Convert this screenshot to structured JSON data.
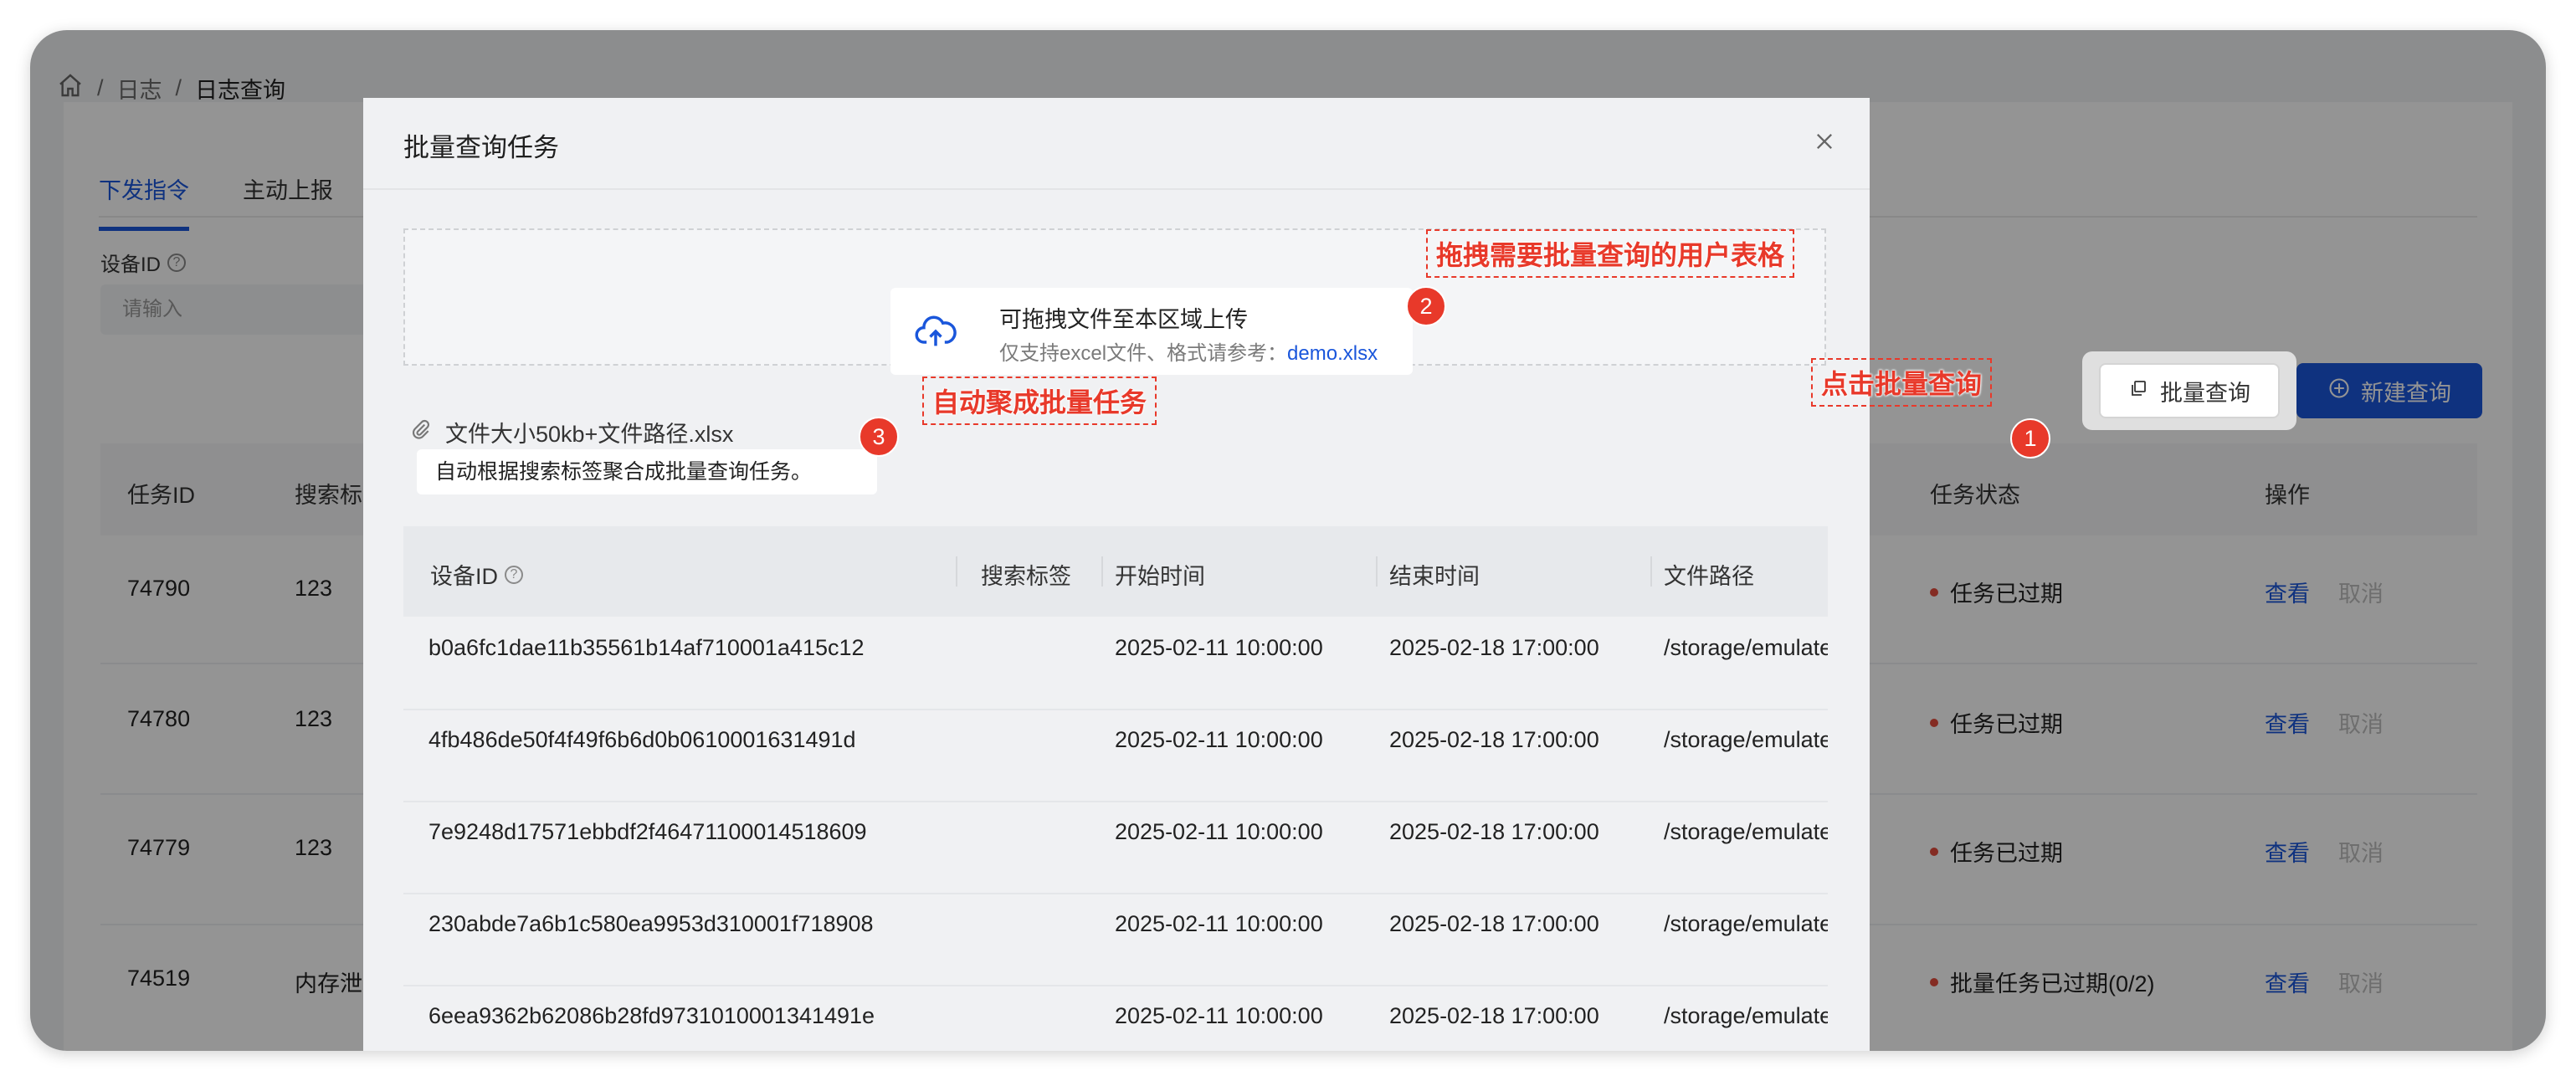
{
  "breadcrumb": {
    "items": [
      "日志",
      "日志查询"
    ]
  },
  "tabs": [
    "下发指令",
    "主动上报"
  ],
  "filter": {
    "label": "设备ID",
    "placeholder": "请输入"
  },
  "toolbar": {
    "batch_label": "批量查询",
    "new_label": "新建查询"
  },
  "table": {
    "columns": {
      "id": "任务ID",
      "tag": "搜索标",
      "status": "任务状态",
      "ops": "操作"
    },
    "rows": [
      {
        "id": "74790",
        "tag": "123",
        "status": "任务已过期",
        "view": "查看",
        "cancel": "取消"
      },
      {
        "id": "74780",
        "tag": "123",
        "status": "任务已过期",
        "view": "查看",
        "cancel": "取消"
      },
      {
        "id": "74779",
        "tag": "123",
        "status": "任务已过期",
        "view": "查看",
        "cancel": "取消"
      },
      {
        "id": "74519",
        "tag": "内存泄",
        "status": "批量任务已过期(0/2)",
        "view": "查看",
        "cancel": "取消"
      }
    ]
  },
  "modal": {
    "title": "批量查询任务",
    "upload": {
      "title": "可拖拽文件至本区域上传",
      "subtitle": "仅支持excel文件、格式请参考：",
      "link": "demo.xlsx"
    },
    "file": "文件大小50kb+文件路径.xlsx",
    "tip": "自动根据搜索标签聚合成批量查询任务。",
    "columns": [
      "设备ID",
      "搜索标签",
      "开始时间",
      "结束时间",
      "文件路径"
    ],
    "rows": [
      {
        "device": "b0a6fc1dae11b35561b14af710001a415c12",
        "tag": "",
        "start": "2025-02-11 10:00:00",
        "end": "2025-02-18 17:00:00",
        "path": "/storage/emulated"
      },
      {
        "device": "4fb486de50f4f49f6b6d0b0610001631491d",
        "tag": "",
        "start": "2025-02-11 10:00:00",
        "end": "2025-02-18 17:00:00",
        "path": "/storage/emulated"
      },
      {
        "device": "7e9248d17571ebbdf2f46471100014518609",
        "tag": "",
        "start": "2025-02-11 10:00:00",
        "end": "2025-02-18 17:00:00",
        "path": "/storage/emulated"
      },
      {
        "device": "230abde7a6b1c580ea9953d310001f718908",
        "tag": "",
        "start": "2025-02-11 10:00:00",
        "end": "2025-02-18 17:00:00",
        "path": "/storage/emulated"
      },
      {
        "device": "6eea9362b62086b28fd9731010001341491e",
        "tag": "",
        "start": "2025-02-11 10:00:00",
        "end": "2025-02-18 17:00:00",
        "path": "/storage/emulated"
      }
    ]
  },
  "annotations": {
    "a1": {
      "num": "1",
      "text": "点击批量查询"
    },
    "a2": {
      "num": "2",
      "text": "拖拽需要批量查询的用户表格"
    },
    "a3": {
      "num": "3",
      "text": "自动聚成批量任务"
    }
  },
  "colors": {
    "accent": "#1a56db",
    "annotation": "#e8392a",
    "status_dot": "#e34d3d"
  }
}
